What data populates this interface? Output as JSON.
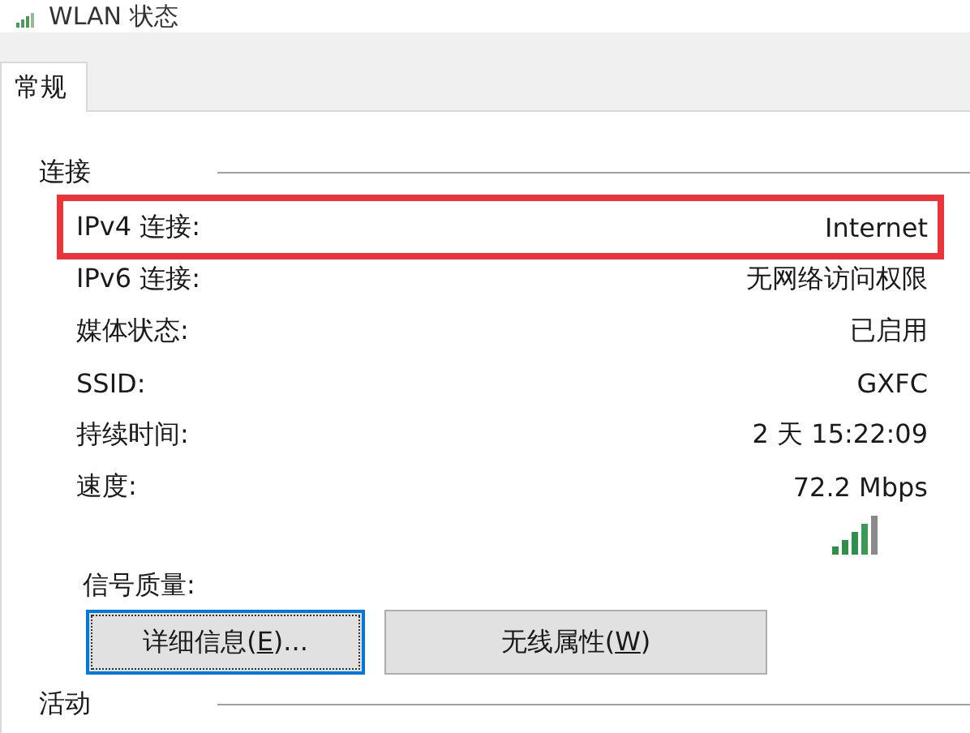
{
  "window": {
    "title": "WLAN 状态"
  },
  "tabs": [
    {
      "label": "常规",
      "selected": true
    }
  ],
  "connection_group": {
    "title": "连接",
    "rows": [
      {
        "label": "IPv4 连接:",
        "value": "Internet",
        "highlighted": true
      },
      {
        "label": "IPv6 连接:",
        "value": "无网络访问权限",
        "highlighted": false
      },
      {
        "label": "媒体状态:",
        "value": "已启用",
        "highlighted": false
      },
      {
        "label": "SSID:",
        "value": "GXFC",
        "highlighted": false
      },
      {
        "label": "持续时间:",
        "value": "2 天 15:22:09",
        "highlighted": false
      },
      {
        "label": "速度:",
        "value": "72.2 Mbps",
        "highlighted": false
      }
    ],
    "signal_label": "信号质量:"
  },
  "buttons": [
    {
      "label_before": "详细信息(",
      "access_key": "E",
      "label_after": ")...",
      "focused": true
    },
    {
      "label_before": "无线属性(",
      "access_key": "W",
      "label_after": ")",
      "focused": false
    }
  ],
  "activity_group": {
    "title": "活动"
  }
}
